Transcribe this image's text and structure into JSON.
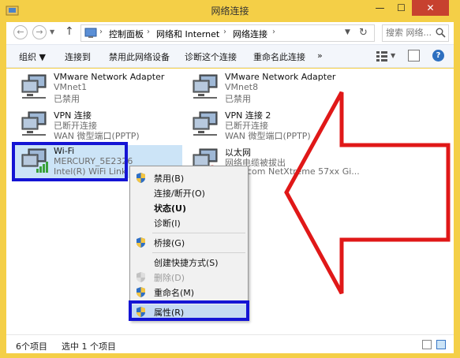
{
  "window": {
    "title": "网络连接",
    "minimize": "—",
    "maximize": "☐",
    "close": "✕"
  },
  "address": {
    "crumbs": [
      "控制面板",
      "网络和 Internet",
      "网络连接"
    ],
    "search_placeholder": "搜索 网络..."
  },
  "toolbar": {
    "items": [
      "组织 ▼",
      "连接到",
      "禁用此网络设备",
      "诊断这个连接",
      "重命名此连接",
      "»"
    ],
    "help": "?"
  },
  "connections": [
    {
      "name": "VMware Network Adapter",
      "line1": "VMnet1",
      "line2": "已禁用",
      "kind": "wired"
    },
    {
      "name": "VMware Network Adapter",
      "line1": "VMnet8",
      "line2": "已禁用",
      "kind": "wired"
    },
    {
      "name": "VPN 连接",
      "line1": "已断开连接",
      "line2": "WAN 微型端口(PPTP)",
      "kind": "wired"
    },
    {
      "name": "VPN 连接 2",
      "line1": "已断开连接",
      "line2": "WAN 微型端口(PPTP)",
      "kind": "wired"
    },
    {
      "name": "Wi-Fi",
      "line1": "MERCURY_5E2326",
      "line2": "Intel(R) WiFi Link 5",
      "kind": "wifi"
    },
    {
      "name": "以太网",
      "line1": "网络电缆被拔出",
      "line2": "com NetXtreme 57xx Gi...",
      "kind": "wired"
    }
  ],
  "context_menu": [
    {
      "label": "禁用(B)",
      "shield": true,
      "style": "normal"
    },
    {
      "label": "连接/断开(O)",
      "shield": false,
      "style": "normal"
    },
    {
      "label": "状态(U)",
      "shield": false,
      "style": "bold"
    },
    {
      "label": "诊断(I)",
      "shield": false,
      "style": "normal"
    },
    {
      "label": "桥接(G)",
      "shield": true,
      "style": "normal"
    },
    {
      "label": "创建快捷方式(S)",
      "shield": false,
      "style": "normal"
    },
    {
      "label": "删除(D)",
      "shield": true,
      "style": "disabled"
    },
    {
      "label": "重命名(M)",
      "shield": true,
      "style": "normal"
    },
    {
      "label": "属性(R)",
      "shield": true,
      "style": "hover"
    }
  ],
  "status": {
    "count": "6个项目",
    "selected": "选中 1 个项目"
  },
  "colors": {
    "highlight_box": "#1414d4",
    "arrow": "#e01818",
    "selection": "#cce4f7",
    "title_bar": "#f4cf47"
  }
}
